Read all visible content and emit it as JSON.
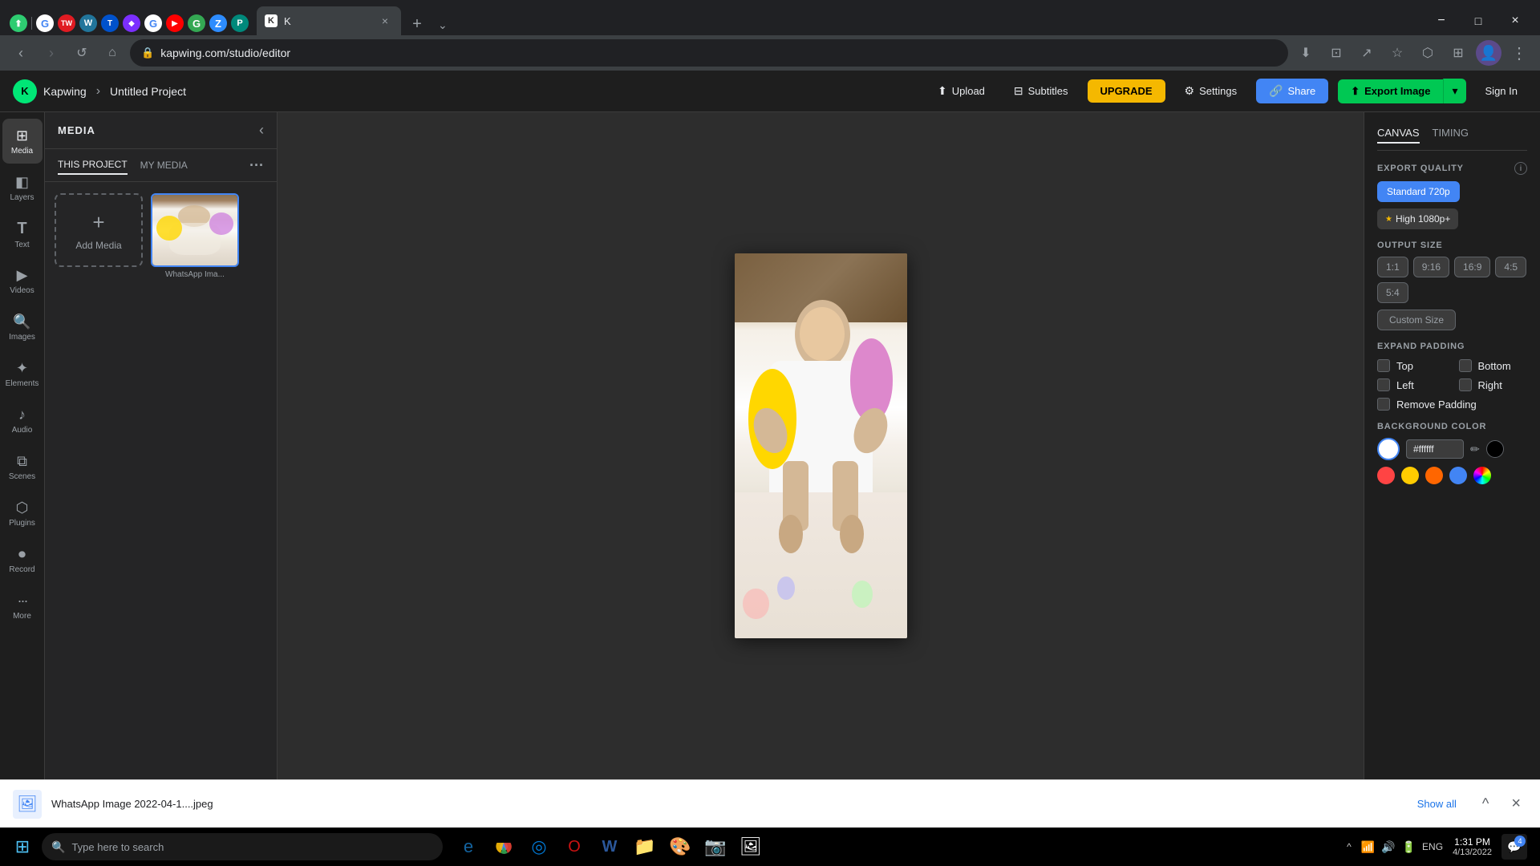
{
  "browser": {
    "favicons": [
      {
        "id": "upwork",
        "char": "⬆",
        "bg": "#2ecc71",
        "color": "#fff"
      },
      {
        "id": "google1",
        "char": "G",
        "bg": "#fff",
        "color": "#4285f4"
      },
      {
        "id": "toggl",
        "char": "TW",
        "bg": "#e01b22",
        "color": "#fff"
      },
      {
        "id": "wordpress",
        "char": "W",
        "bg": "#21759b",
        "color": "#fff"
      },
      {
        "id": "trello",
        "char": "T",
        "bg": "#0052cc",
        "color": "#fff"
      },
      {
        "id": "figma",
        "char": "◆",
        "bg": "#7b2fff",
        "color": "#fff"
      },
      {
        "id": "google2",
        "char": "G",
        "bg": "#fff",
        "color": "#4285f4"
      },
      {
        "id": "youtube1",
        "char": "▶",
        "bg": "#ff0000",
        "color": "#fff"
      },
      {
        "id": "gsuite",
        "char": "G",
        "bg": "#34a853",
        "color": "#fff"
      },
      {
        "id": "zoom",
        "char": "Z",
        "bg": "#2d8cff",
        "color": "#fff"
      },
      {
        "id": "pcloud",
        "char": "P",
        "bg": "#00897b",
        "color": "#fff"
      }
    ],
    "active_tab": {
      "favicon": "k",
      "title": "K",
      "close": "×"
    },
    "address": "kapwing.com/studio/editor",
    "window_controls": [
      "−",
      "□",
      "×"
    ]
  },
  "topbar": {
    "logo_initial": "K",
    "app_name": "Kapwing",
    "separator": "›",
    "project_name": "Untitled Project",
    "upload_label": "Upload",
    "subtitles_label": "Subtitles",
    "upgrade_label": "UPGRADE",
    "settings_label": "Settings",
    "share_label": "Share",
    "export_label": "Export Image",
    "export_dropdown": "▾",
    "sign_in_label": "Sign In"
  },
  "left_sidebar": {
    "items": [
      {
        "id": "media",
        "icon": "⊞",
        "label": "Media",
        "active": true
      },
      {
        "id": "layers",
        "icon": "◧",
        "label": "Layers"
      },
      {
        "id": "text",
        "icon": "T",
        "label": "Text"
      },
      {
        "id": "videos",
        "icon": "▶",
        "label": "Videos"
      },
      {
        "id": "images",
        "icon": "🖼",
        "label": "Images"
      },
      {
        "id": "elements",
        "icon": "✦",
        "label": "Elements"
      },
      {
        "id": "audio",
        "icon": "♪",
        "label": "Audio"
      },
      {
        "id": "scenes",
        "icon": "◈",
        "label": "Scenes"
      },
      {
        "id": "plugins",
        "icon": "⬡",
        "label": "Plugins"
      },
      {
        "id": "record",
        "icon": "⏺",
        "label": "Record"
      },
      {
        "id": "more",
        "icon": "•••",
        "label": "More"
      }
    ]
  },
  "media_panel": {
    "title": "MEDIA",
    "tab_this_project": "THIS PROJECT",
    "tab_my_media": "MY MEDIA",
    "add_media_label": "Add Media",
    "media_items": [
      {
        "name": "WhatsApp Ima _",
        "short": "WhatsApp Ima..."
      }
    ]
  },
  "right_panel": {
    "tab_canvas": "CANVAS",
    "tab_timing": "TIMING",
    "export_quality_label": "EXPORT QUALITY",
    "quality_standard": "Standard 720p",
    "quality_high": "High 1080p+",
    "output_size_label": "OUTPUT SIZE",
    "sizes": [
      "1:1",
      "9:16",
      "16:9",
      "4:5",
      "5:4"
    ],
    "custom_size_label": "Custom Size",
    "expand_padding_label": "EXPAND PADDING",
    "padding_top": "Top",
    "padding_bottom": "Bottom",
    "padding_left": "Left",
    "padding_right": "Right",
    "remove_padding_label": "Remove Padding",
    "background_color_label": "BACKGROUND COLOR",
    "color_hex": "#ffffff",
    "color_swatches": [
      "#ffffff",
      "#000000",
      "#ff4444",
      "#ffcc00",
      "#ff6600",
      "#4285f4",
      "gradient"
    ]
  },
  "bottom_bar": {
    "file_name": "WhatsApp Image 2022-04-1....jpeg",
    "show_all_label": "Show all",
    "close_label": "×",
    "collapse_label": "^"
  },
  "taskbar": {
    "search_placeholder": "Type here to search",
    "tray_time": "1:31 PM",
    "tray_date": "4/13/2022",
    "tray_lang": "ENG",
    "notification_count": "4",
    "taskbar_apps": [
      {
        "id": "ie",
        "char": "e",
        "color": "#1464a0"
      },
      {
        "id": "chrome",
        "char": "⊙",
        "color": "#4285f4"
      },
      {
        "id": "edge",
        "char": "◎",
        "color": "#0078d4"
      },
      {
        "id": "opera",
        "char": "O",
        "color": "#cc1212"
      },
      {
        "id": "word",
        "char": "W",
        "color": "#2b579a"
      },
      {
        "id": "files",
        "char": "📁",
        "color": "#f0c040"
      },
      {
        "id": "paint",
        "char": "🎨",
        "color": "#00a651"
      },
      {
        "id": "camera",
        "char": "📷",
        "color": "#555"
      },
      {
        "id": "photos",
        "char": "🖼",
        "color": "#0078d4"
      }
    ]
  }
}
